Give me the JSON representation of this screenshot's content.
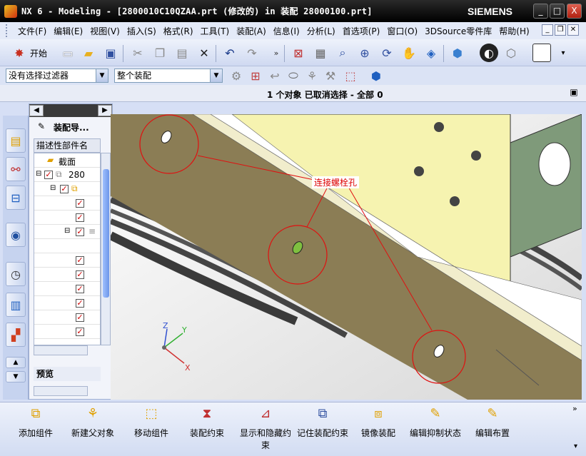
{
  "window": {
    "title": "NX 6 - Modeling - [2800010C10QZAA.prt  (修改的)   in 装配 28000100.prt]",
    "brand": "SIEMENS",
    "controls": [
      "_",
      "□",
      "X"
    ]
  },
  "menubar": {
    "items": [
      "文件(F)",
      "编辑(E)",
      "视图(V)",
      "插入(S)",
      "格式(R)",
      "工具(T)",
      "装配(A)",
      "信息(I)",
      "分析(L)",
      "首选项(P)",
      "窗口(O)",
      "3DSource零件库",
      "帮助(H)"
    ]
  },
  "toolbar": {
    "start_label": "开始",
    "icons": [
      "start-icon",
      "new-file-icon",
      "open-folder-icon",
      "save-icon",
      "cut-icon",
      "copy-icon",
      "paste-icon",
      "delete-icon",
      "undo-icon",
      "redo-icon",
      "fit-icon",
      "zoom-region-icon",
      "zoom-icon",
      "zoom-in-out-icon",
      "rotate-icon",
      "pan-icon",
      "cube-view-icon",
      "shaded-icon",
      "render-style-icon",
      "wireframe-icon",
      "background-icon"
    ]
  },
  "filterbar": {
    "selection_filter": "没有选择过滤器",
    "scope": "整个装配"
  },
  "status": {
    "message": "1 个对象 已取消选择 - 全部 0"
  },
  "navigator": {
    "title": "装配导...",
    "column_header": "描述性部件名",
    "tree": [
      {
        "label": "截面",
        "indent": 1,
        "checked": null
      },
      {
        "label": "280",
        "indent": 0,
        "checked": true
      },
      {
        "label": "",
        "indent": 1,
        "checked": true
      },
      {
        "label": "",
        "indent": 2,
        "checked": true
      },
      {
        "label": "",
        "indent": 2,
        "checked": true
      },
      {
        "label": "",
        "indent": 2,
        "checked": true
      },
      {
        "label": "",
        "indent": 2,
        "checked": true
      },
      {
        "label": "",
        "indent": 2,
        "checked": true
      },
      {
        "label": "",
        "indent": 2,
        "checked": true
      },
      {
        "label": "",
        "indent": 2,
        "checked": true
      },
      {
        "label": "",
        "indent": 2,
        "checked": true
      },
      {
        "label": "",
        "indent": 2,
        "checked": true
      }
    ],
    "preview_label": "预览"
  },
  "viewport": {
    "annotation": "连接螺栓孔",
    "highlight_color": "#e01010",
    "plate_color": "#8b7d55",
    "block_color": "#f6f3b0",
    "axes": [
      "X",
      "Y",
      "Z"
    ]
  },
  "bottombar": {
    "buttons": [
      {
        "label": "添加组件",
        "icon": "add-component-icon"
      },
      {
        "label": "新建父对象",
        "icon": "new-parent-icon"
      },
      {
        "label": "移动组件",
        "icon": "move-component-icon"
      },
      {
        "label": "装配约束",
        "icon": "assembly-constraint-icon"
      },
      {
        "label": "显示和隐藏约束",
        "icon": "show-hide-constraint-icon"
      },
      {
        "label": "记住装配约束",
        "icon": "remember-constraint-icon"
      },
      {
        "label": "镜像装配",
        "icon": "mirror-assembly-icon"
      },
      {
        "label": "编辑抑制状态",
        "icon": "edit-suppression-icon"
      },
      {
        "label": "编辑布置",
        "icon": "edit-arrangement-icon"
      }
    ]
  }
}
